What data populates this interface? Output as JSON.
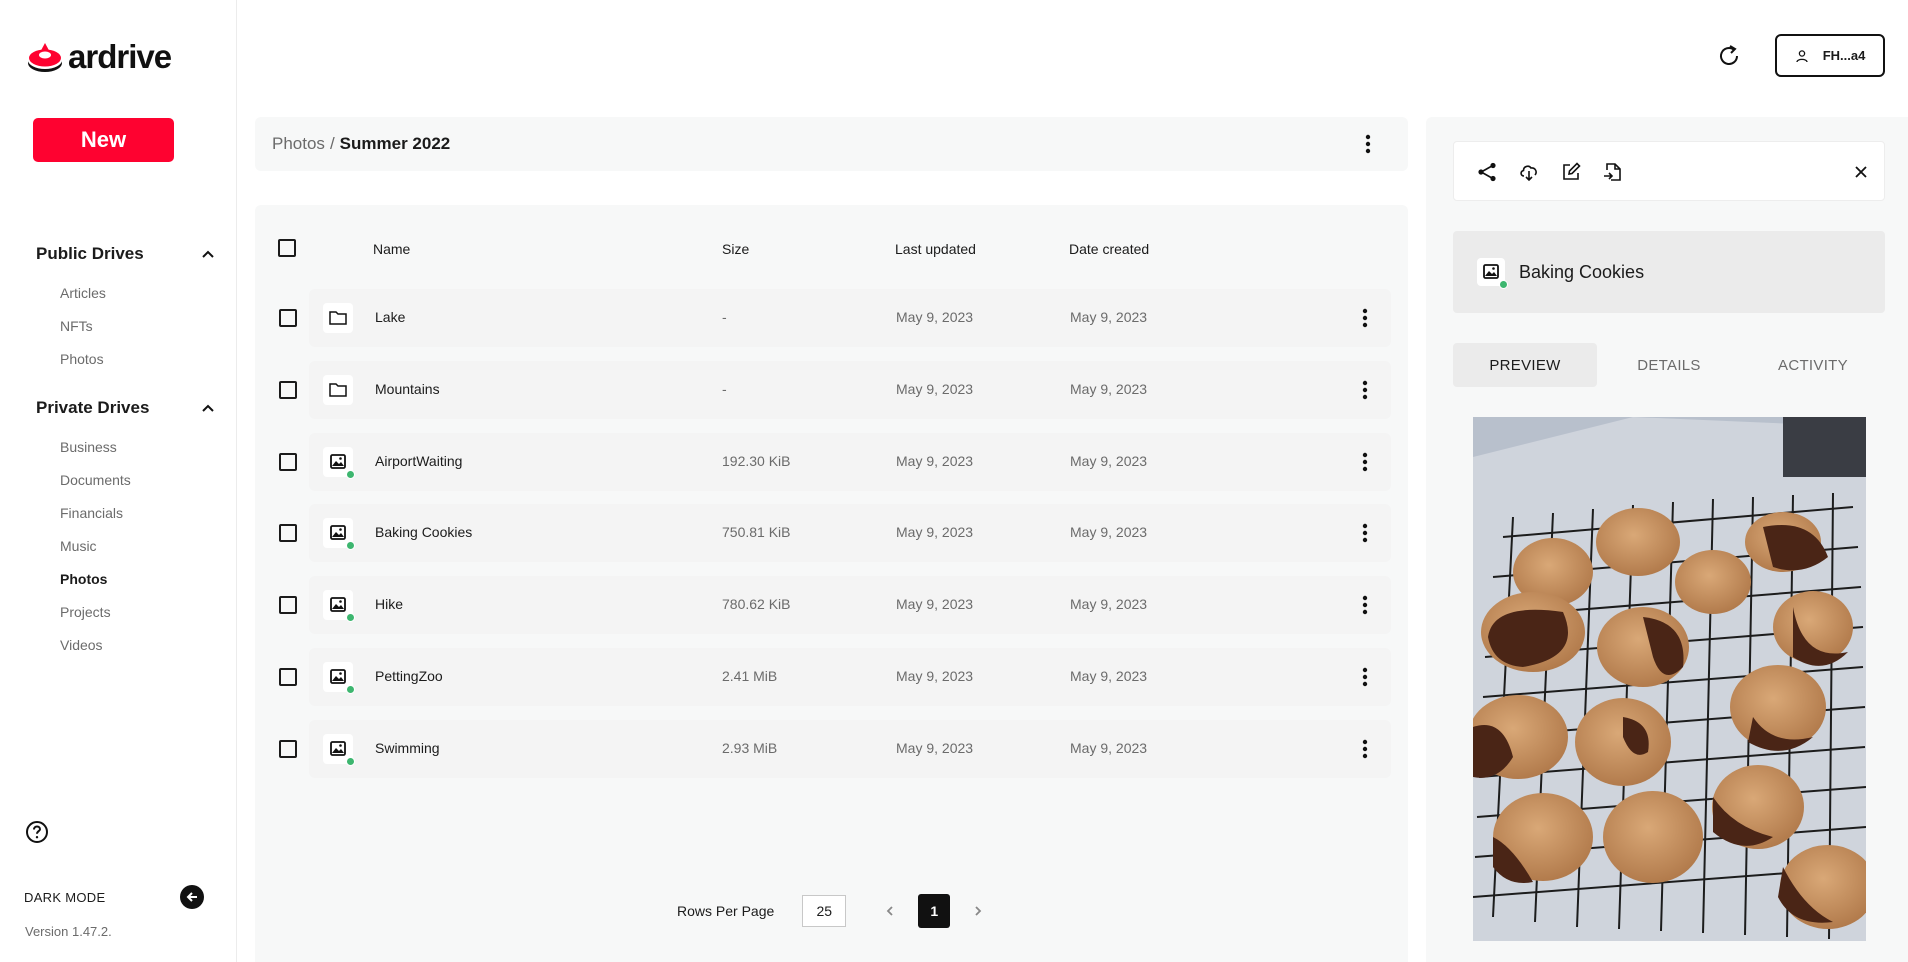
{
  "app": {
    "logo_text": "ardrive",
    "new_button": "New",
    "user_label": "FH...a4",
    "version": "Version 1.47.2.",
    "dark_mode_label": "DARK MODE"
  },
  "sidebar": {
    "public": {
      "label": "Public Drives",
      "items": [
        "Articles",
        "NFTs",
        "Photos"
      ]
    },
    "private": {
      "label": "Private Drives",
      "items": [
        "Business",
        "Documents",
        "Financials",
        "Music",
        "Photos",
        "Projects",
        "Videos"
      ],
      "active_index": 4
    }
  },
  "breadcrumb": {
    "parent": "Photos",
    "separator": "/",
    "current": "Summer 2022"
  },
  "table": {
    "headers": {
      "name": "Name",
      "size": "Size",
      "updated": "Last updated",
      "created": "Date created"
    },
    "rows": [
      {
        "type": "folder",
        "name": "Lake",
        "size": "-",
        "updated": "May 9, 2023",
        "created": "May 9, 2023"
      },
      {
        "type": "folder",
        "name": "Mountains",
        "size": "-",
        "updated": "May 9, 2023",
        "created": "May 9, 2023"
      },
      {
        "type": "image",
        "name": "AirportWaiting",
        "size": "192.30 KiB",
        "updated": "May 9, 2023",
        "created": "May 9, 2023"
      },
      {
        "type": "image",
        "name": "Baking Cookies",
        "size": "750.81 KiB",
        "updated": "May 9, 2023",
        "created": "May 9, 2023"
      },
      {
        "type": "image",
        "name": "Hike",
        "size": "780.62 KiB",
        "updated": "May 9, 2023",
        "created": "May 9, 2023"
      },
      {
        "type": "image",
        "name": "PettingZoo",
        "size": "2.41 MiB",
        "updated": "May 9, 2023",
        "created": "May 9, 2023"
      },
      {
        "type": "image",
        "name": "Swimming",
        "size": "2.93 MiB",
        "updated": "May 9, 2023",
        "created": "May 9, 2023"
      }
    ]
  },
  "pagination": {
    "rows_label": "Rows Per Page",
    "rows_per_page": "25",
    "current_page": "1"
  },
  "details": {
    "title": "Baking Cookies",
    "tabs": [
      "PREVIEW",
      "DETAILS",
      "ACTIVITY"
    ],
    "active_tab": 0
  },
  "colors": {
    "brand": "#fe0230",
    "synced": "#3db66f"
  }
}
